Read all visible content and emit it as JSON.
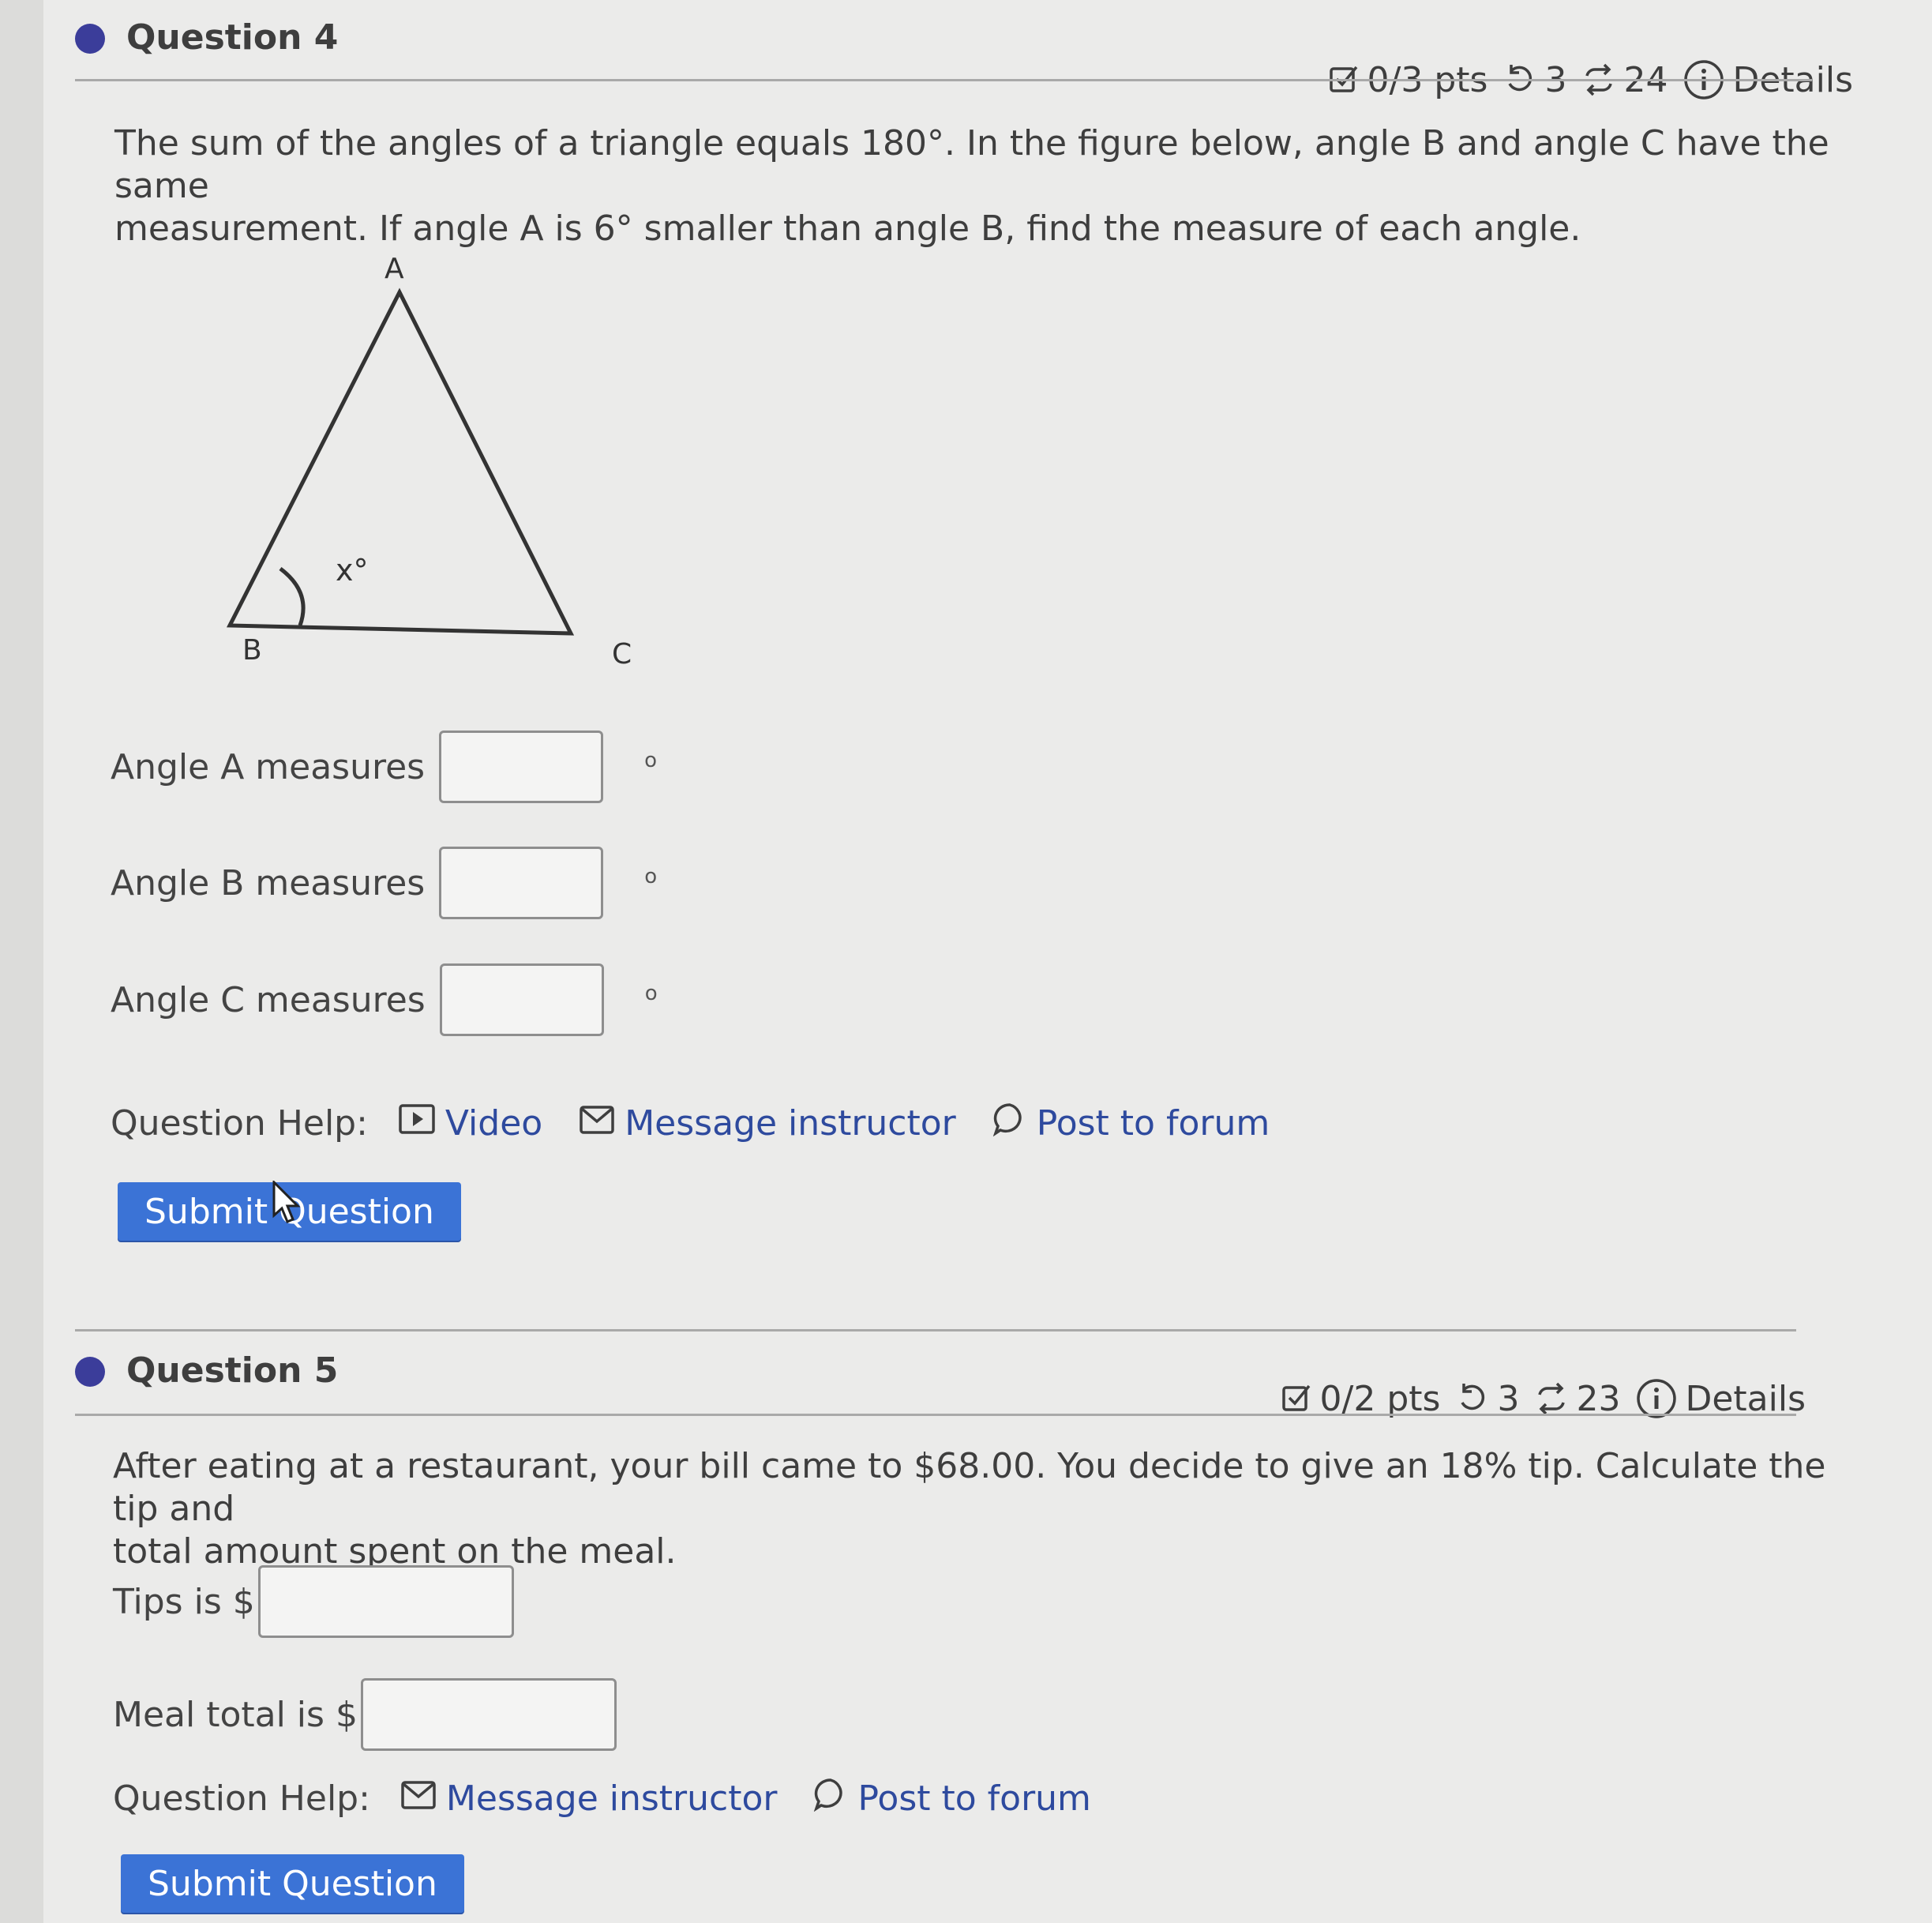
{
  "question4": {
    "title": "Question 4",
    "meta": {
      "points": "0/3 pts",
      "retries": "3",
      "attempts": "24",
      "details": "Details"
    },
    "prompt_line1": "The sum of the angles of a triangle equals 180°. In the figure below, angle B and angle C have the same",
    "prompt_line2": "measurement. If angle A is 6° smaller than angle B, find the measure of each angle.",
    "figure": {
      "vertex_a": "A",
      "vertex_b": "B",
      "vertex_c": "C",
      "angle_label": "x°"
    },
    "answers": [
      {
        "label": "Angle A measures",
        "value": "",
        "suffix": "o"
      },
      {
        "label": "Angle B measures",
        "value": "",
        "suffix": "o"
      },
      {
        "label": "Angle C measures",
        "value": "",
        "suffix": "o"
      }
    ],
    "help": {
      "label": "Question Help:",
      "video": "Video",
      "message": "Message instructor",
      "forum": "Post to forum"
    },
    "submit": "Submit Question"
  },
  "question5": {
    "title": "Question 5",
    "meta": {
      "points": "0/2 pts",
      "retries": "3",
      "attempts": "23",
      "details": "Details"
    },
    "prompt_line1": "After eating at a restaurant, your bill came to $68.00. You decide to give an 18% tip. Calculate the tip and",
    "prompt_line2": "total amount spent on the meal.",
    "answers": [
      {
        "label": "Tips is $",
        "value": ""
      },
      {
        "label": "Meal total is $",
        "value": ""
      }
    ],
    "help": {
      "label": "Question Help:",
      "message": "Message instructor",
      "forum": "Post to forum"
    },
    "submit": "Submit Question"
  },
  "colors": {
    "accent_blue": "#3b73d6",
    "link_blue": "#2e4a9e",
    "bullet": "#3b3d9a",
    "background": "#ebebea"
  }
}
